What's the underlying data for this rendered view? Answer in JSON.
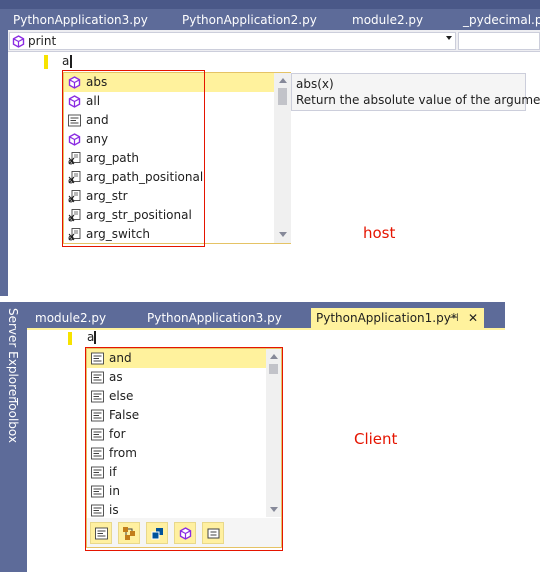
{
  "host": {
    "tabs": [
      "PythonApplication3.py",
      "PythonApplication2.py",
      "module2.py",
      "_pydecimal.py"
    ],
    "nav_dropdown": "print",
    "typed_text": "a",
    "completion_items": [
      {
        "label": "abs",
        "icon": "method-icon",
        "selected": true
      },
      {
        "label": "all",
        "icon": "method-icon"
      },
      {
        "label": "and",
        "icon": "keyword-icon"
      },
      {
        "label": "any",
        "icon": "method-icon"
      },
      {
        "label": "arg_path",
        "icon": "snippet-icon"
      },
      {
        "label": "arg_path_positional",
        "icon": "snippet-icon"
      },
      {
        "label": "arg_str",
        "icon": "snippet-icon"
      },
      {
        "label": "arg_str_positional",
        "icon": "snippet-icon"
      },
      {
        "label": "arg_switch",
        "icon": "snippet-icon"
      }
    ],
    "tooltip": {
      "signature": "abs(x)",
      "description": "Return the absolute value of the argument."
    },
    "annotation": "host"
  },
  "client": {
    "side_tabs": [
      "Server Explorer",
      "Toolbox"
    ],
    "tabs": [
      "module2.py",
      "PythonApplication3.py",
      "PythonApplication1.py*"
    ],
    "active_tab_pin": "⊣",
    "active_tab_close": "✕",
    "typed_text": "a",
    "completion_items": [
      {
        "label": "and",
        "icon": "keyword-icon",
        "selected": true
      },
      {
        "label": "as",
        "icon": "keyword-icon"
      },
      {
        "label": "else",
        "icon": "keyword-icon"
      },
      {
        "label": "False",
        "icon": "keyword-icon"
      },
      {
        "label": "for",
        "icon": "keyword-icon"
      },
      {
        "label": "from",
        "icon": "keyword-icon"
      },
      {
        "label": "if",
        "icon": "keyword-icon"
      },
      {
        "label": "in",
        "icon": "keyword-icon"
      },
      {
        "label": "is",
        "icon": "keyword-icon"
      }
    ],
    "filter_buttons": [
      "keyword-filter-icon",
      "class-filter-icon",
      "module-filter-icon",
      "method-filter-icon",
      "field-filter-icon"
    ],
    "annotation": "Client"
  },
  "colors": {
    "tab_bar": "#5d6b99",
    "active_tab": "#fff29d",
    "selection": "#fff29d",
    "annotation_red": "#e51400",
    "method_purple": "#8a2be2"
  }
}
